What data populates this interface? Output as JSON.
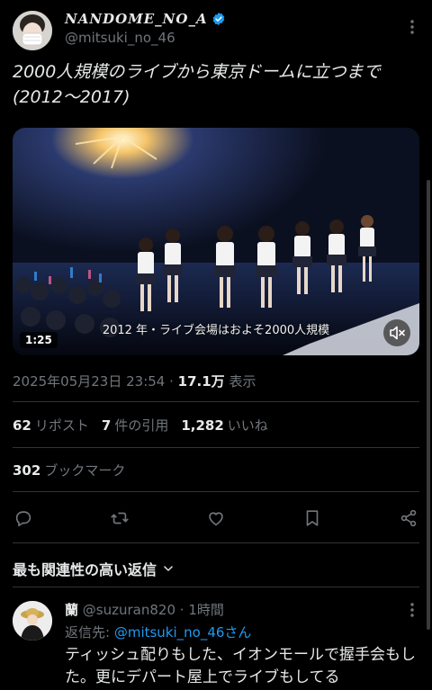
{
  "author": {
    "display_name": "NANDOME_NO_A",
    "handle": "@mitsuki_no_46",
    "verified_icon": "verified-badge-icon",
    "badge_color": "#1d9bf0"
  },
  "tweet": {
    "text": "2000人規模のライブから東京ドームに立つまで(2012〜2017)",
    "video": {
      "duration": "1:25",
      "subtitle": "2012 年・ライブ会場はおよそ2000人規模"
    },
    "timestamp": "2025年05月23日 23:54",
    "views_count": "17.1万",
    "views_label": "表示",
    "separator": " · "
  },
  "stats": {
    "reposts_count": "62",
    "reposts_label": "リポスト",
    "quotes_count": "7",
    "quotes_label": "件の引用",
    "likes_count": "1,282",
    "likes_label": "いいね",
    "bookmarks_count": "302",
    "bookmarks_label": "ブックマーク"
  },
  "actions": [
    "reply-icon",
    "repost-icon",
    "like-icon",
    "bookmark-icon",
    "share-icon"
  ],
  "replies_sort": {
    "label": "最も関連性の高い返信"
  },
  "reply": {
    "name": "蘭",
    "handle": "@suzuran820",
    "time": "1時間",
    "reply_to_label": "返信先: ",
    "reply_to_link": "@mitsuki_no_46さん",
    "text": "ティッシュ配りもした、イオンモールで握手会もした。更にデパート屋上でライブもしてる"
  },
  "colors": {
    "background": "#000000",
    "text_primary": "#e7e9ea",
    "text_secondary": "#71767b",
    "link": "#1d9bf0"
  }
}
